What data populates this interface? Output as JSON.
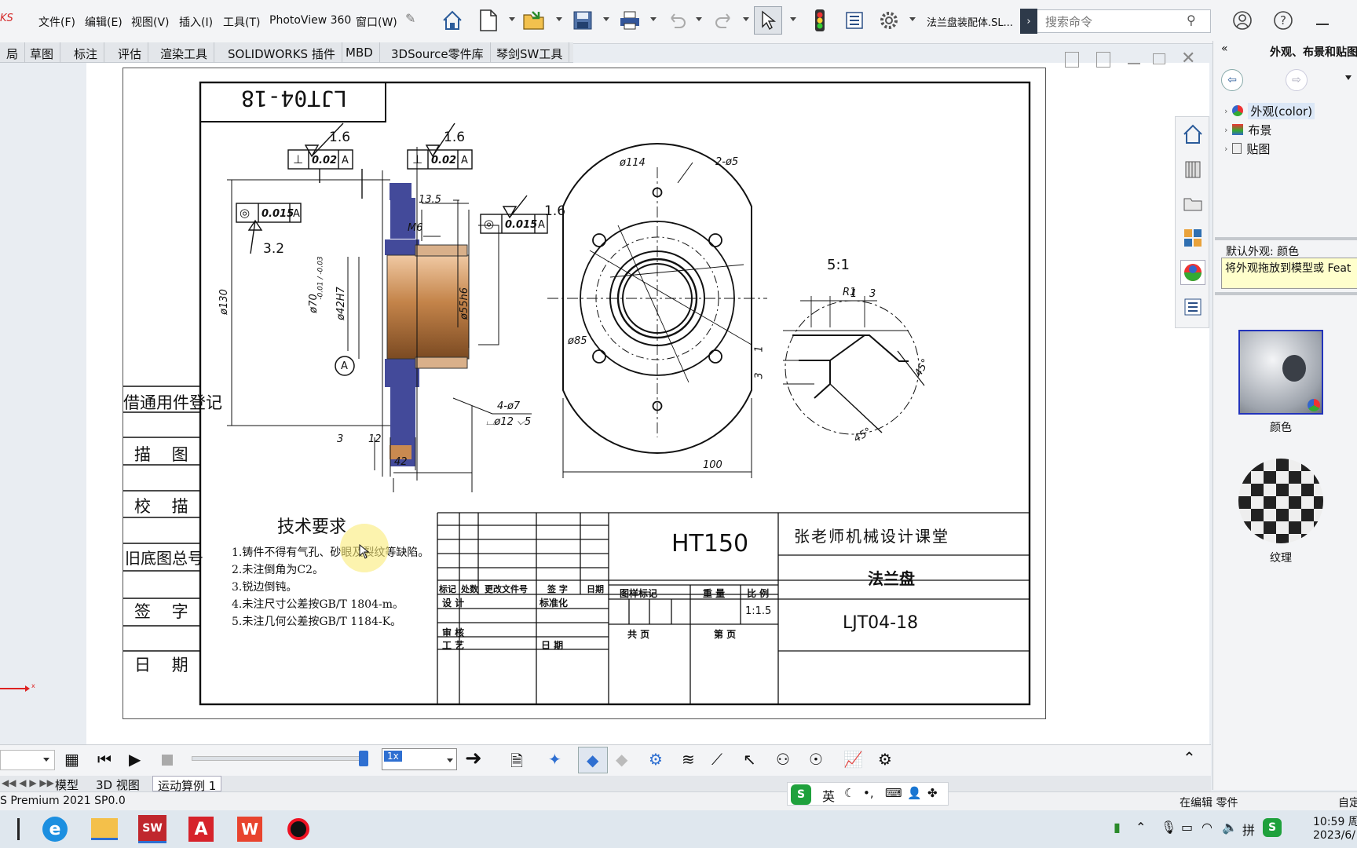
{
  "app": {
    "logo_fragment": "KS",
    "doc_title": "法兰盘装配体.SL...",
    "accent": "#1c6fd1"
  },
  "menu": {
    "items": [
      "文件(F)",
      "编辑(E)",
      "视图(V)",
      "插入(I)",
      "工具(T)",
      "PhotoView 360",
      "窗口(W)"
    ]
  },
  "search": {
    "placeholder": "搜索命令"
  },
  "ribbon_tabs": [
    "局",
    "草图",
    "标注",
    "评估",
    "渲染工具",
    "SOLIDWORKS 插件",
    "MBD",
    "3DSource零件库",
    "琴剑SW工具"
  ],
  "drawing": {
    "title_flipped": "LJT04-18",
    "side_labels": [
      "借通用件登记",
      "描  图",
      "校  描",
      "旧底图总号",
      "签  字",
      "日  期"
    ],
    "roughness_marks": [
      "1.6",
      "1.6",
      "1.6",
      "3.2"
    ],
    "tolerance_frames": [
      {
        "sym": "⊥",
        "val": "0.02",
        "datum": "A"
      },
      {
        "sym": "⊥",
        "val": "0.02",
        "datum": "A"
      },
      {
        "sym": "◎",
        "val": "0.015",
        "datum": "A"
      },
      {
        "sym": "◎",
        "val": "0.015",
        "datum": "A"
      }
    ],
    "dims": {
      "d130": "ø130",
      "d70": "ø70",
      "d70_tol": "-0.01 / -0.03",
      "d42": "ø42H7",
      "d55": "ø55h6",
      "d13_5": "13.5",
      "m6": "M6",
      "datum_a": "A",
      "d3": "3",
      "d12": "12",
      "d42len": "42",
      "holes4": "4-ø7",
      "cbore": "⌴ø12 ⌵5",
      "d114": "ø114",
      "holes2": "2-ø5",
      "d85": "ø85",
      "d100": "100",
      "scale_detail": "5:1",
      "r1": "R1",
      "one": "1",
      "three": "3",
      "v1": "1",
      "v3": "3",
      "a45a": "45°",
      "a45b": "45°"
    },
    "tech_title": "技术要求",
    "tech_items": [
      "1.铸件不得有气孔、砂眼及裂纹等缺陷。",
      "2.未注倒角为C2。",
      "3.锐边倒钝。",
      "4.未注尺寸公差按GB/T 1804-m。",
      "5.未注几何公差按GB/T 1184-K。"
    ],
    "title_block": {
      "material": "HT150",
      "company": "张老师机械设计课堂",
      "part_name": "法兰盘",
      "drawing_no": "LJT04-18",
      "scale": "1:1.5",
      "labels": {
        "mark": "标记",
        "count": "处数",
        "change_doc": "更改文件号",
        "sign": "签 字",
        "date": "日期",
        "design": "设 计",
        "standard": "标准化",
        "review": "审 核",
        "process": "工 艺",
        "date2": "日 期",
        "stage": "图样标记",
        "weight": "重 量",
        "ratio": "比 例",
        "total": "共    页",
        "page": "第    页"
      }
    }
  },
  "right_panel": {
    "title": "外观、布景和贴图",
    "tree": [
      "外观(color)",
      "布景",
      "贴图"
    ],
    "default_label": "默认外观: 颜色",
    "hint": "将外观拖放到模型或 Feat",
    "swatches": [
      "颜色",
      "纹理"
    ]
  },
  "motion": {
    "speed_value": "1x",
    "tabs": [
      "模型",
      "3D 视图",
      "运动算例 1"
    ]
  },
  "status": {
    "left": "S Premium 2021 SP0.0",
    "right": "在编辑 零件",
    "far_right": "自定"
  },
  "ime": {
    "lang": "英"
  },
  "taskbar": {
    "time": "10:59 周",
    "date": "2023/6/"
  }
}
